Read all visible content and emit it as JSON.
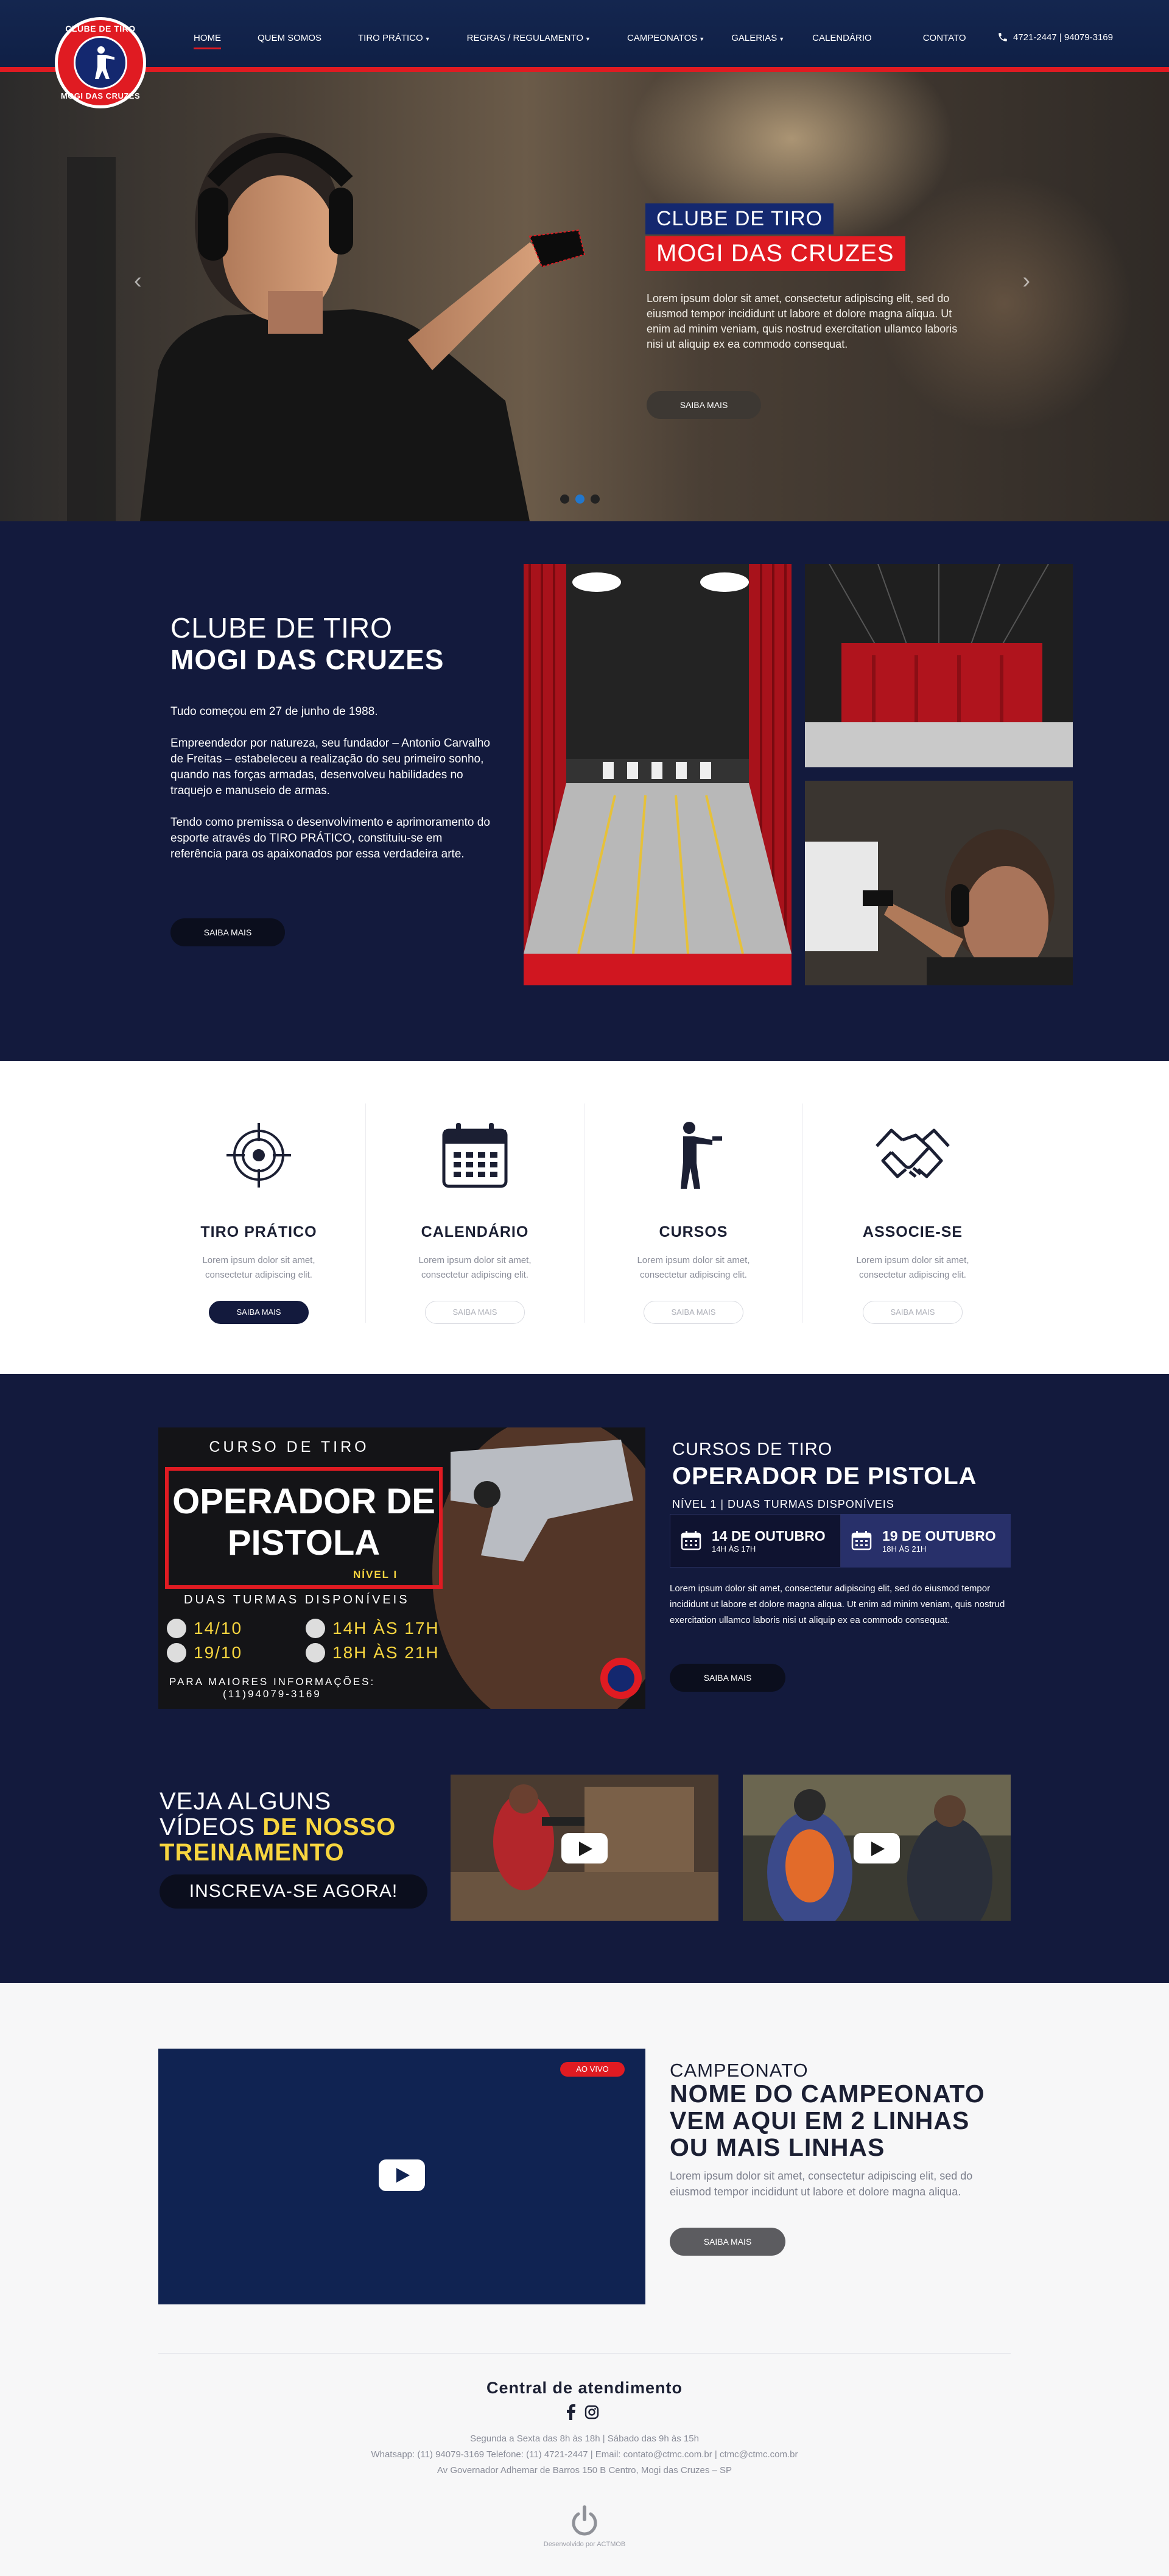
{
  "brand": {
    "logo_top": "CLUBE DE TIRO",
    "logo_bottom": "MOGI DAS CRUZES",
    "red": "#e01b22",
    "navy": "#131a3d",
    "blue": "#14286f"
  },
  "nav": {
    "items": [
      {
        "label": "HOME",
        "active": true
      },
      {
        "label": "QUEM SOMOS"
      },
      {
        "label": "TIRO PRÁTICO",
        "dropdown": true
      },
      {
        "label": "REGRAS / REGULAMENTO",
        "dropdown": true
      },
      {
        "label": "CAMPEONATOS",
        "dropdown": true
      },
      {
        "label": "GALERIAS",
        "dropdown": true
      },
      {
        "label": "CALENDÁRIO"
      },
      {
        "label": "CONTATO"
      }
    ],
    "phone": "4721-2447 | 94079-3169"
  },
  "hero": {
    "tag1": "CLUBE DE TIRO",
    "tag2": "MOGI DAS CRUZES",
    "text": "Lorem ipsum dolor sit amet, consectetur adipiscing elit, sed do eiusmod tempor incididunt ut labore et dolore magna aliqua. Ut enim ad minim veniam, quis nostrud exercitation ullamco laboris nisi ut aliquip ex ea commodo consequat.",
    "button": "SAIBA MAIS",
    "slides": 3,
    "active_slide": 2
  },
  "about": {
    "title_line1": "CLUBE DE TIRO",
    "title_line2": "MOGI DAS CRUZES",
    "paragraphs": [
      "Tudo começou em 27 de junho de 1988.",
      "Empreendedor por natureza, seu fundador – Antonio Carvalho de Freitas – estabeleceu a realização do seu primeiro sonho, quando nas forças armadas, desenvolveu habilidades no traquejo e manuseio de armas.",
      "Tendo como premissa o desenvolvimento e aprimoramento do esporte através do TIRO PRÁTICO, constituiu-se em referência para os apaixonados por essa verdadeira arte."
    ],
    "button": "SAIBA MAIS"
  },
  "services": [
    {
      "icon": "target-icon",
      "title": "TIRO PRÁTICO",
      "desc": "Lorem ipsum dolor sit amet, consectetur adipiscing elit.",
      "button": "SAIBA MAIS",
      "dark": true
    },
    {
      "icon": "calendar-icon",
      "title": "CALENDÁRIO",
      "desc": "Lorem ipsum dolor sit amet, consectetur adipiscing elit.",
      "button": "SAIBA MAIS"
    },
    {
      "icon": "shooter-icon",
      "title": "CURSOS",
      "desc": "Lorem ipsum dolor sit amet, consectetur adipiscing elit.",
      "button": "SAIBA MAIS"
    },
    {
      "icon": "handshake-icon",
      "title": "ASSOCIE-SE",
      "desc": "Lorem ipsum dolor sit amet, consectetur adipiscing elit.",
      "button": "SAIBA MAIS"
    }
  ],
  "course": {
    "poster": {
      "top": "CURSO DE TIRO",
      "title1": "OPERADOR DE",
      "title2": "PISTOLA",
      "level": "NÍVEL I",
      "sub": "DUAS TURMAS DISPONÍVEIS",
      "date1": "14/10",
      "date2": "19/10",
      "time1": "14H ÀS 17H",
      "time2": "18H ÀS 21H",
      "info": "PARA MAIORES INFORMAÇÕES:",
      "phone": "(11)94079-3169"
    },
    "category": "CURSOS DE TIRO",
    "name": "OPERADOR DE PISTOLA",
    "level": "NÍVEL 1  |  DUAS TURMAS DISPONÍVEIS",
    "dates": [
      {
        "date": "14 DE OUTUBRO",
        "time": "14H ÀS 17H"
      },
      {
        "date": "19 DE OUTUBRO",
        "time": "18H ÀS 21H"
      }
    ],
    "text": "Lorem ipsum dolor sit amet, consectetur adipiscing elit, sed do eiusmod tempor incididunt ut labore et dolore magna aliqua. Ut enim ad minim veniam, quis nostrud exercitation ullamco laboris nisi ut aliquip ex ea commodo consequat.",
    "button": "SAIBA MAIS"
  },
  "videos": {
    "line1": "VEJA ALGUNS",
    "line2a": "VÍDEOS ",
    "line2b": "DE NOSSO",
    "line3": "TREINAMENTO",
    "cta": "INSCREVA-SE AGORA!",
    "accent": "#f7d53f"
  },
  "championship": {
    "live": "AO VIVO",
    "label": "CAMPEONATO",
    "title": "NOME DO CAMPEONATO VEM AQUI EM 2 LINHAS OU MAIS LINHAS",
    "desc": "Lorem ipsum dolor sit amet, consectetur adipiscing elit, sed do eiusmod tempor incididunt ut labore et dolore magna aliqua.",
    "button": "SAIBA MAIS"
  },
  "footer": {
    "heading": "Central de atendimento",
    "hours": "Segunda a Sexta das 8h às 18h   |   Sábado das 9h às 15h",
    "contacts": "Whatsapp: (11) 94079-3169    Telefone: (11) 4721-2447   |   Email: contato@ctmc.com.br   |   ctmc@ctmc.com.br",
    "address": "Av Governador Adhemar de Barros 150 B Centro, Mogi das Cruzes – SP",
    "dev": "Desenvolvido por ACTMOB"
  }
}
